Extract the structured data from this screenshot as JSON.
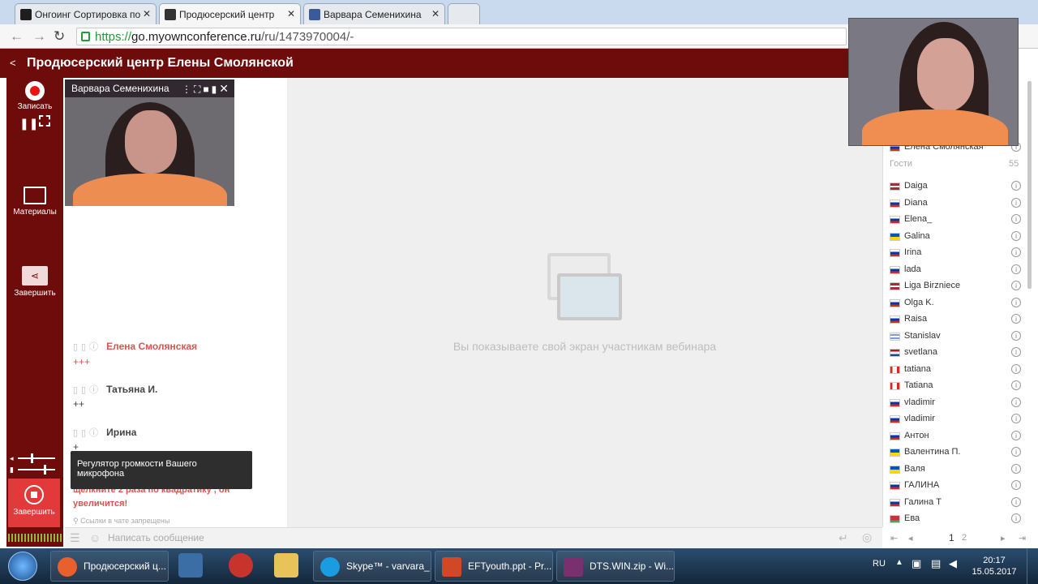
{
  "browser": {
    "tabs": [
      {
        "title": "Онгоинг Сортировка по",
        "color": "#1e1e1e"
      },
      {
        "title": "Продюсерский центр",
        "color": "#333333"
      },
      {
        "title": "Варвара Семенихина",
        "color": "#3c5a99"
      }
    ],
    "url_scheme": "https://",
    "url_host": "go.myownconference.ru",
    "url_path": "/ru/1473970004/-"
  },
  "app": {
    "title": "Продюсерский центр Елены Смолянской",
    "accent": "#6e0c0c"
  },
  "sidebar": {
    "record_label": "Записать",
    "materials_label": "Материалы",
    "finish_share_label": "Завершить",
    "stop_label": "Завершить"
  },
  "video": {
    "name": "Варвара Семенихина"
  },
  "chat": {
    "messages": [
      {
        "author": "Елена Смолянская",
        "text": "+++"
      },
      {
        "author": "Татьяна И.",
        "text": "++"
      },
      {
        "author": "Ирина",
        "text": "+"
      }
    ],
    "partial_text_1": "щелкните 2 раза по квадратику , он",
    "partial_text_2": "увеличится!",
    "links_note": "Ссылки в чате запрещены",
    "input_placeholder": "Написать сообщение"
  },
  "tooltip": {
    "text": "Регулятор громкости Вашего микрофона"
  },
  "main": {
    "share_message": "Вы показываете свой экран участникам вебинара"
  },
  "participants": {
    "host": "Елена Смолянская",
    "guests_label": "Гости",
    "guests_count": "55",
    "users": [
      {
        "name": "Daiga",
        "flag": "lv"
      },
      {
        "name": "Diana",
        "flag": "ru"
      },
      {
        "name": "Elena_",
        "flag": "ru"
      },
      {
        "name": "Galina",
        "flag": "ua"
      },
      {
        "name": "Irina",
        "flag": "ru"
      },
      {
        "name": "lada",
        "flag": "ru"
      },
      {
        "name": "Liga Birzniece",
        "flag": "lv"
      },
      {
        "name": "Olga K.",
        "flag": "ru"
      },
      {
        "name": "Raisa",
        "flag": "ru"
      },
      {
        "name": "Stanislav",
        "flag": "il"
      },
      {
        "name": "svetlana",
        "flag": "nl"
      },
      {
        "name": "tatiana",
        "flag": "ca"
      },
      {
        "name": "Tatiana",
        "flag": "ca"
      },
      {
        "name": "vladimir",
        "flag": "ru"
      },
      {
        "name": "vladimir",
        "flag": "ru"
      },
      {
        "name": "Антон",
        "flag": "ru"
      },
      {
        "name": "Валентина П.",
        "flag": "ua"
      },
      {
        "name": "Валя",
        "flag": "ua"
      },
      {
        "name": "ГАЛИНА",
        "flag": "ru"
      },
      {
        "name": "Галина Т",
        "flag": "ru"
      },
      {
        "name": "Ева",
        "flag": "by"
      }
    ],
    "page_current": "1",
    "page_next": "2"
  },
  "taskbar": {
    "items": [
      {
        "label": "Продюсерский ц...",
        "color": "#e8612c"
      },
      {
        "label": "Skype™ - varvara_...",
        "color": "#1a9ce0"
      },
      {
        "label": "EFTyouth.ppt - Pr...",
        "color": "#d24726"
      },
      {
        "label": "DTS.WIN.zip - Wi...",
        "color": "#7a2f6e"
      }
    ],
    "lang": "RU",
    "time": "20:17",
    "date": "15.05.2017"
  }
}
